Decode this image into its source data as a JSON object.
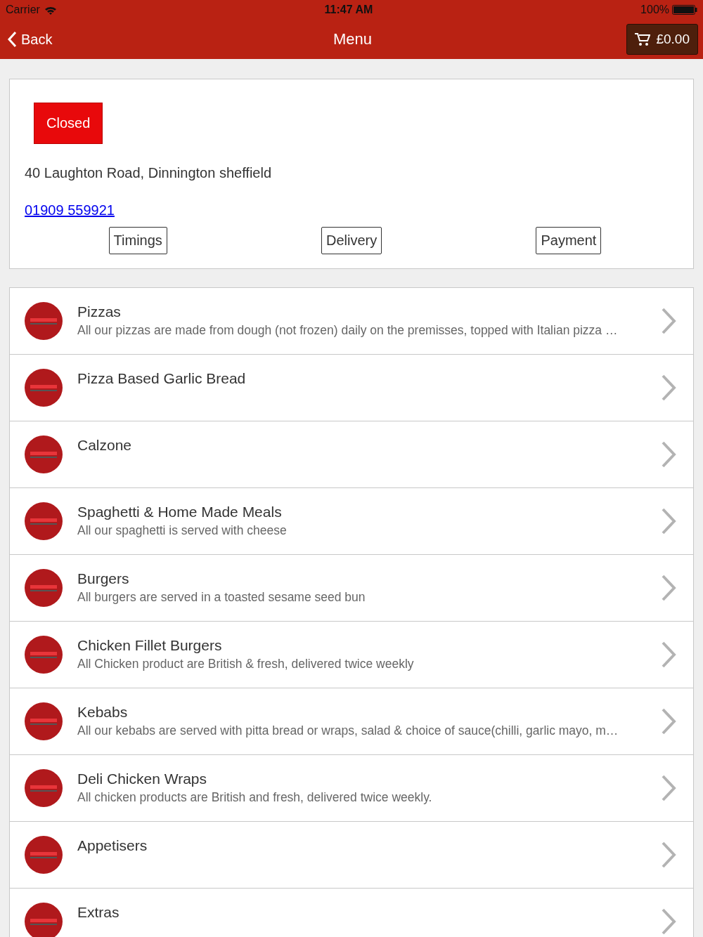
{
  "status_bar": {
    "carrier": "Carrier",
    "time": "11:47 AM",
    "battery": "100%"
  },
  "nav": {
    "back": "Back",
    "title": "Menu",
    "cart": "£0.00"
  },
  "store": {
    "status": {
      "label": "Closed",
      "kind": "closed"
    },
    "address": "40 Laughton Road, Dinnington sheffield",
    "phone": "01909 559921",
    "buttons": [
      "Timings",
      "Delivery",
      "Payment"
    ]
  },
  "categories": [
    {
      "name": "Pizzas",
      "description": "All our pizzas are made from dough (not frozen) daily on the premisses, topped with Italian pizza …"
    },
    {
      "name": "Pizza Based Garlic Bread"
    },
    {
      "name": "Calzone"
    },
    {
      "name": "Spaghetti & Home Made Meals",
      "description": "All our spaghetti is served with cheese"
    },
    {
      "name": "Burgers",
      "description": "All burgers are served in a toasted sesame seed bun"
    },
    {
      "name": "Chicken Fillet Burgers",
      "description": "All Chicken product are British & fresh, delivered twice weekly"
    },
    {
      "name": "Kebabs",
      "description": "All our kebabs are served with pitta bread or wraps, salad & choice of sauce(chilli, garlic mayo, m…"
    },
    {
      "name": "Deli Chicken Wraps",
      "description": "All chicken products are British and fresh, delivered twice weekly."
    },
    {
      "name": "Appetisers"
    },
    {
      "name": "Extras"
    }
  ]
}
